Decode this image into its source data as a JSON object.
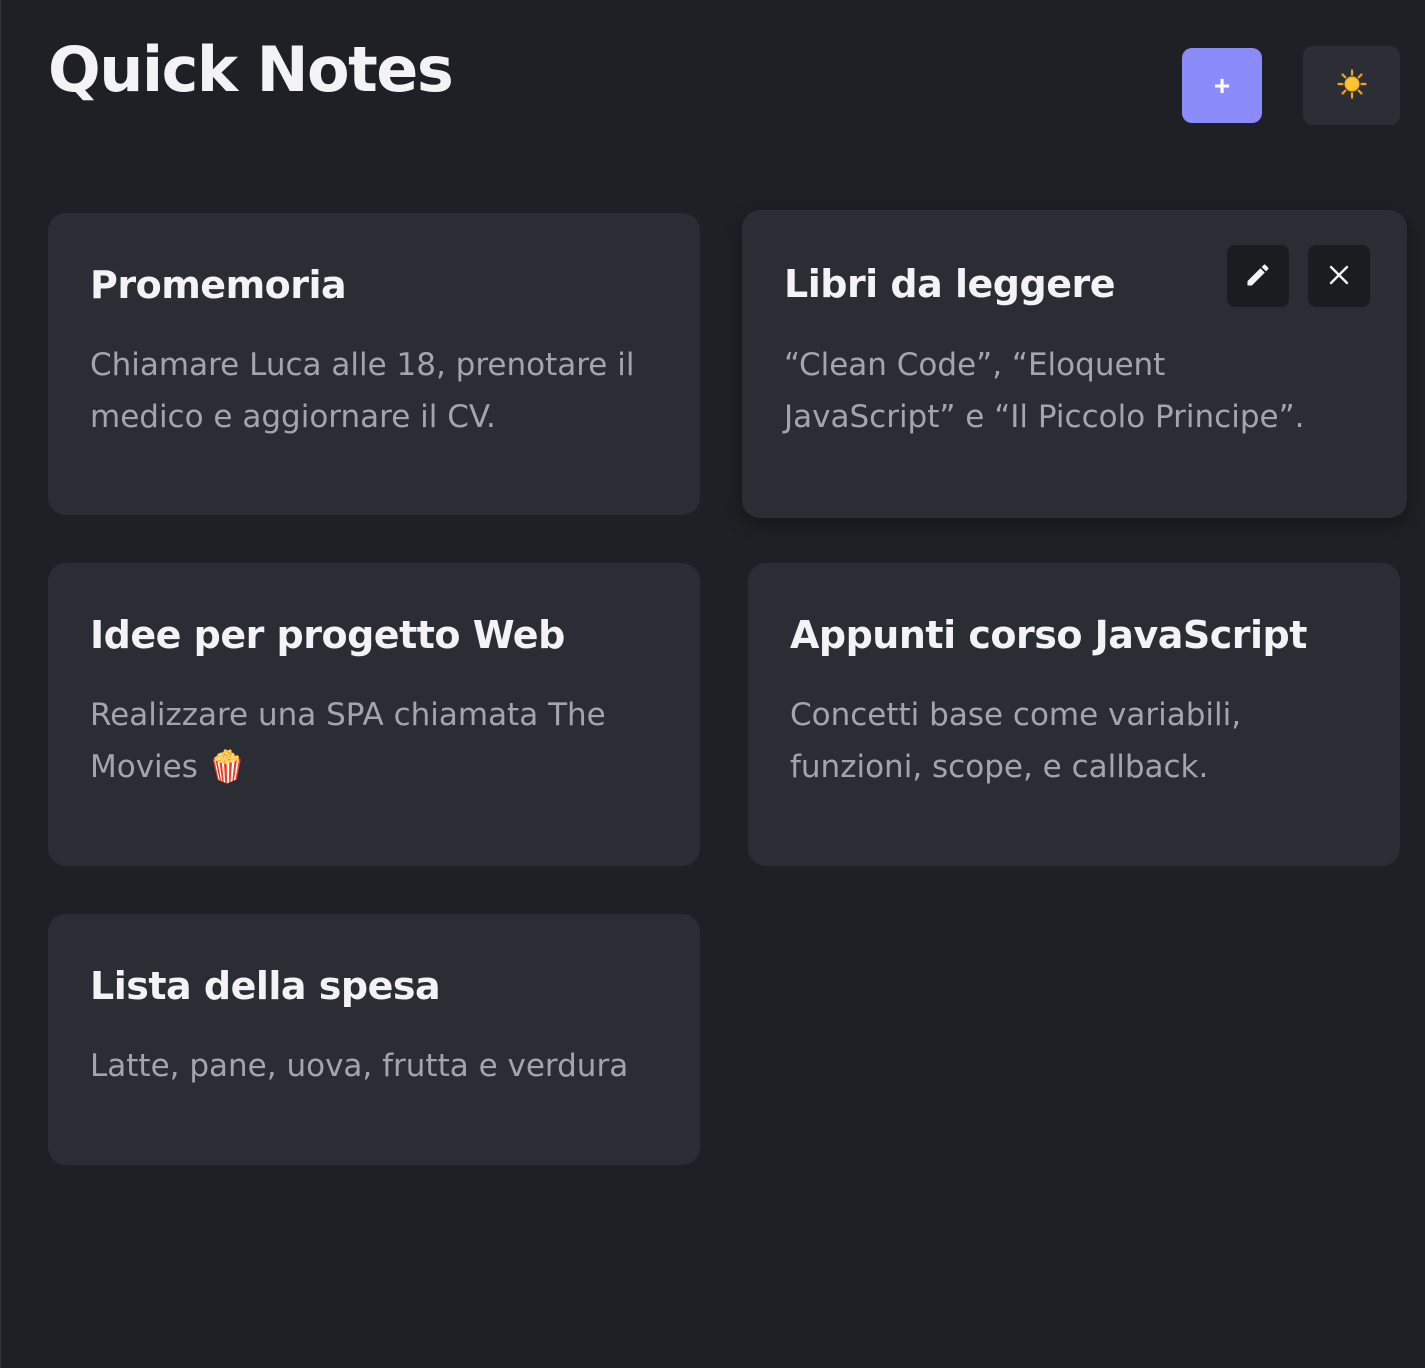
{
  "header": {
    "title": "Quick Notes",
    "add_label": "+",
    "theme_icon": "sun-icon"
  },
  "notes": [
    {
      "title": "Promemoria",
      "body": "Chiamare Luca alle 18, prenotare il medico e aggiornare il CV."
    },
    {
      "title": "Libri da leggere",
      "body": "“Clean Code”, “Eloquent JavaScript” e “Il Piccolo Principe”.",
      "hovered": true,
      "actions": [
        "pencil-icon",
        "close-icon"
      ]
    },
    {
      "title": "Idee per progetto Web",
      "body": "Realizzare una SPA chiamata The Movies 🍿"
    },
    {
      "title": "Appunti corso JavaScript",
      "body": "Concetti base come variabili, funzioni, scope, e callback."
    },
    {
      "title": "Lista della spesa",
      "body": "Latte, pane, uova, frutta e verdura"
    }
  ],
  "colors": {
    "background": "#1f2025",
    "card": "#2b2d35",
    "accent": "#8b8cfa",
    "title_text": "#f3f3f5",
    "body_text": "#a3a5ae"
  }
}
